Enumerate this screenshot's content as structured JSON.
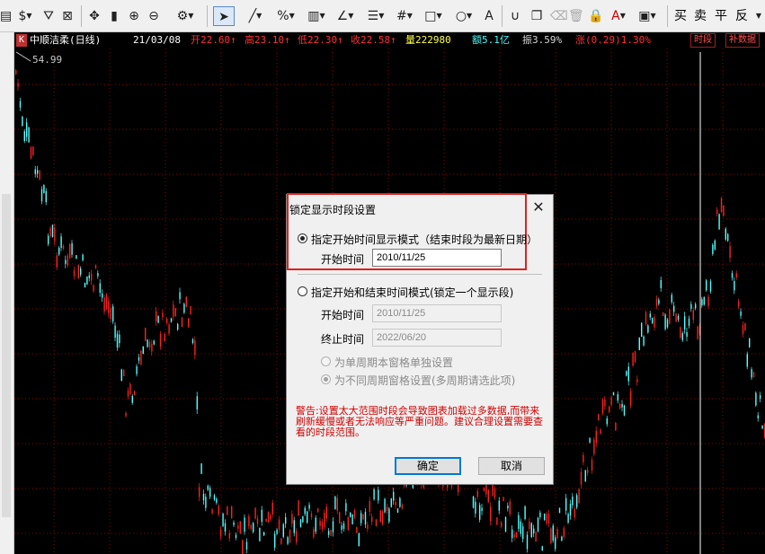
{
  "toolbar": {
    "icons": [
      "doc-icon",
      "dollar-icon",
      "filter-icon",
      "zoom-box-icon",
      "move-icon",
      "bar-icon",
      "zoom-in-icon",
      "zoom-out-icon",
      "gear-icon",
      "cursor-icon",
      "line-icon",
      "percent-icon",
      "grid-icon",
      "angle-icon",
      "fib-icon",
      "hash-icon",
      "rect-icon",
      "circle-icon",
      "text-icon",
      "magnet-icon",
      "copy-icon",
      "delete-icon",
      "trash-icon",
      "lock-icon",
      "color-icon",
      "save-icon"
    ],
    "buy_label": "买",
    "sell_label": "卖",
    "flat_label": "平",
    "reverse_label": "反"
  },
  "infobar": {
    "k_label": "K",
    "stock": "中顺洁柔(日线)",
    "date": "21/03/08",
    "open": "开22.60↑",
    "high": "高23.10↑",
    "low": "低22.30↑",
    "close": "收22.58↑",
    "volume": "量222980",
    "amount": "额5.1亿",
    "amplitude": "振3.59%",
    "change": "涨(0.29)1.30%",
    "timeseg_button": "时段",
    "supplement_button": "补数据"
  },
  "chart": {
    "high_label": "54.99",
    "up_color": "#ff2020",
    "down_color": "#54ffff",
    "grid_color": "#8a0000"
  },
  "dialog": {
    "title": "锁定显示时段设置",
    "mode1_label": "指定开始时间显示模式（结束时段为最新日期）",
    "mode1_start_label": "开始时间",
    "mode1_start_value": "2010/11/25",
    "mode2_label": "指定开始和结束时间模式(锁定一个显示段)",
    "mode2_start_label": "开始时间",
    "mode2_start_value": "2010/11/25",
    "mode2_end_label": "终止时间",
    "mode2_end_value": "2022/06/20",
    "opt_single": "为单周期本窗格单独设置",
    "opt_multi": "为不同周期窗格设置(多周期请选此项)",
    "warning": "警告:设置太大范围时段会导致图表加载过多数据,而带来刷新缓慢或者无法响应等严重问题。建议合理设置需要查看的时段范围。",
    "ok_label": "确定",
    "cancel_label": "取消"
  }
}
